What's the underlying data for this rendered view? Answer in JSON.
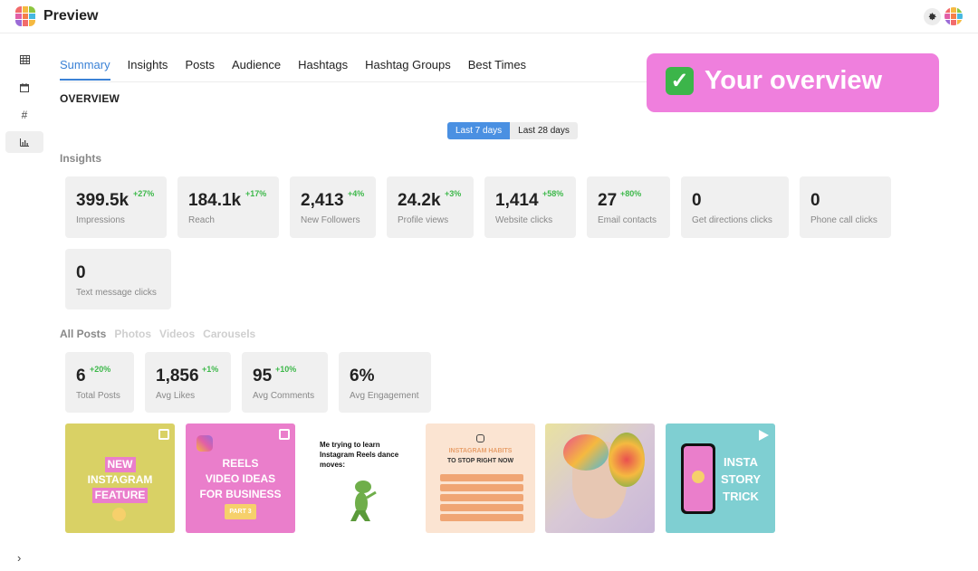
{
  "app": {
    "title": "Preview"
  },
  "sidebar": {
    "items": [
      {
        "icon": "grid-icon"
      },
      {
        "icon": "calendar-icon"
      },
      {
        "icon": "hashtag-icon",
        "glyph": "#"
      },
      {
        "icon": "bar-chart-icon",
        "active": true
      }
    ]
  },
  "tabs": [
    {
      "label": "Summary",
      "active": true
    },
    {
      "label": "Insights"
    },
    {
      "label": "Posts"
    },
    {
      "label": "Audience"
    },
    {
      "label": "Hashtags"
    },
    {
      "label": "Hashtag Groups"
    },
    {
      "label": "Best Times"
    }
  ],
  "overview": {
    "title": "OVERVIEW"
  },
  "range": {
    "options": [
      "Last 7 days",
      "Last 28 days"
    ],
    "selected": "Last 7 days"
  },
  "insights": {
    "label": "Insights",
    "cards": [
      {
        "value": "399.5k",
        "delta": "+27%",
        "label": "Impressions"
      },
      {
        "value": "184.1k",
        "delta": "+17%",
        "label": "Reach"
      },
      {
        "value": "2,413",
        "delta": "+4%",
        "label": "New Followers"
      },
      {
        "value": "24.2k",
        "delta": "+3%",
        "label": "Profile views"
      },
      {
        "value": "1,414",
        "delta": "+58%",
        "label": "Website clicks"
      },
      {
        "value": "27",
        "delta": "+80%",
        "label": "Email contacts"
      },
      {
        "value": "0",
        "delta": "",
        "label": "Get directions clicks"
      },
      {
        "value": "0",
        "delta": "",
        "label": "Phone call clicks"
      },
      {
        "value": "0",
        "delta": "",
        "label": "Text message clicks"
      }
    ]
  },
  "posts": {
    "filters": [
      {
        "label": "All Posts",
        "active": true
      },
      {
        "label": "Photos"
      },
      {
        "label": "Videos"
      },
      {
        "label": "Carousels"
      }
    ],
    "cards": [
      {
        "value": "6",
        "delta": "+20%",
        "label": "Total Posts"
      },
      {
        "value": "1,856",
        "delta": "+1%",
        "label": "Avg Likes"
      },
      {
        "value": "95",
        "delta": "+10%",
        "label": "Avg Comments"
      },
      {
        "value": "6%",
        "delta": "",
        "label": "Avg Engagement"
      }
    ],
    "thumbnails": {
      "t1": [
        "NEW",
        "INSTAGRAM",
        "FEATURE"
      ],
      "t2": [
        "REELS",
        "VIDEO IDEAS",
        "FOR BUSINESS",
        "PART 3"
      ],
      "t3": [
        "Me trying to learn",
        "Instagram Reels dance",
        "moves:"
      ],
      "t4": [
        "INSTAGRAM HABITS",
        "TO STOP RIGHT NOW"
      ],
      "t6": [
        "INSTA",
        "STORY",
        "TRICK"
      ]
    }
  },
  "badge": {
    "text": "Your overview"
  },
  "colors": {
    "accent": "#3b82d6",
    "positive": "#3db84a",
    "badge": "#ef7fdd"
  }
}
